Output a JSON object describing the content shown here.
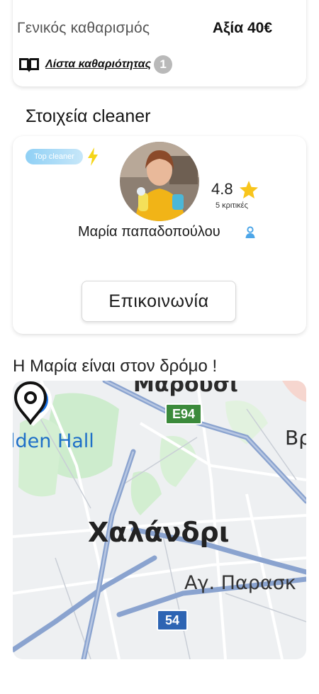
{
  "summary": {
    "service_name": "Γενικός καθαρισμός",
    "price": "Αξία 40€",
    "checklist_link": "Λίστα καθαριότητας",
    "checklist_count": "1"
  },
  "cleaner_section": {
    "title": "Στοιχεία cleaner",
    "badge": "Top cleaner",
    "rating": "4.8",
    "reviews": "5 κριτικές",
    "name": "Μαρία παπαδοπούλου",
    "contact_button": "Επικοινωνία"
  },
  "status": {
    "text": "Η Μαρία είναι στον δρόμο !"
  },
  "map": {
    "labels": {
      "marousi": "Μαρούσι",
      "hall": "lden Hall",
      "br": "Βρ",
      "chalandri": "Χαλάνδρι",
      "agia_paraskevi": "Αγ. Παρασκ"
    },
    "shields": {
      "e94": "E94",
      "r54": "54"
    }
  },
  "colors": {
    "badge_blue": "#8fd0f5",
    "bolt_yellow": "#f5d517",
    "star_yellow": "#f8c51c",
    "verified_blue": "#4da6e8",
    "map_pin_blue": "#1a73e8"
  },
  "icons": {
    "book": "book-open-icon",
    "bolt": "lightning-bolt-icon",
    "star": "star-icon",
    "verified": "user-verified-icon",
    "bag_pin": "shopping-bag-pin-icon",
    "location_pin": "location-pin-icon"
  }
}
